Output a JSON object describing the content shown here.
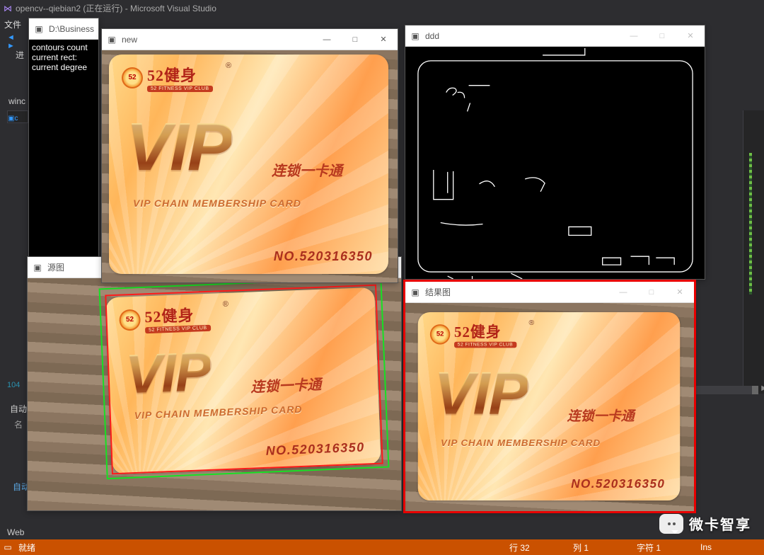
{
  "vs": {
    "title": "opencv--qiebian2 (正在运行) - Microsoft Visual Studio",
    "menu_file": "文件",
    "nav_back": "◄",
    "nav_fwd": "►",
    "proj": "进",
    "winc": "winc",
    "gutter_line": "104",
    "autos_tab": "自动",
    "col_name": "名",
    "locals_tab": "自动",
    "web_tab": "Web"
  },
  "console": {
    "title": "D:\\Business",
    "line1": "contours count",
    "line2": "current rect:",
    "line3": "current degree"
  },
  "windows": {
    "new": {
      "title": "new",
      "min": "—",
      "max": "□",
      "close": "✕"
    },
    "ddd": {
      "title": "ddd"
    },
    "source": {
      "title": "源图"
    },
    "result": {
      "title": "结果图"
    }
  },
  "card": {
    "sun_text": "52",
    "brand_cn": "52健身",
    "brand_en": "52 FITNESS VIP CLUB",
    "reg": "®",
    "vip": "VIP",
    "chain_zh": "连锁一卡通",
    "chain_en": "VIP CHAIN MEMBERSHIP CARD",
    "number": "NO.520316350"
  },
  "status": {
    "ready": "就绪",
    "line": "行 32",
    "col": "列 1",
    "char": "字符 1",
    "ins": "Ins"
  },
  "watermark": "微卡智享"
}
